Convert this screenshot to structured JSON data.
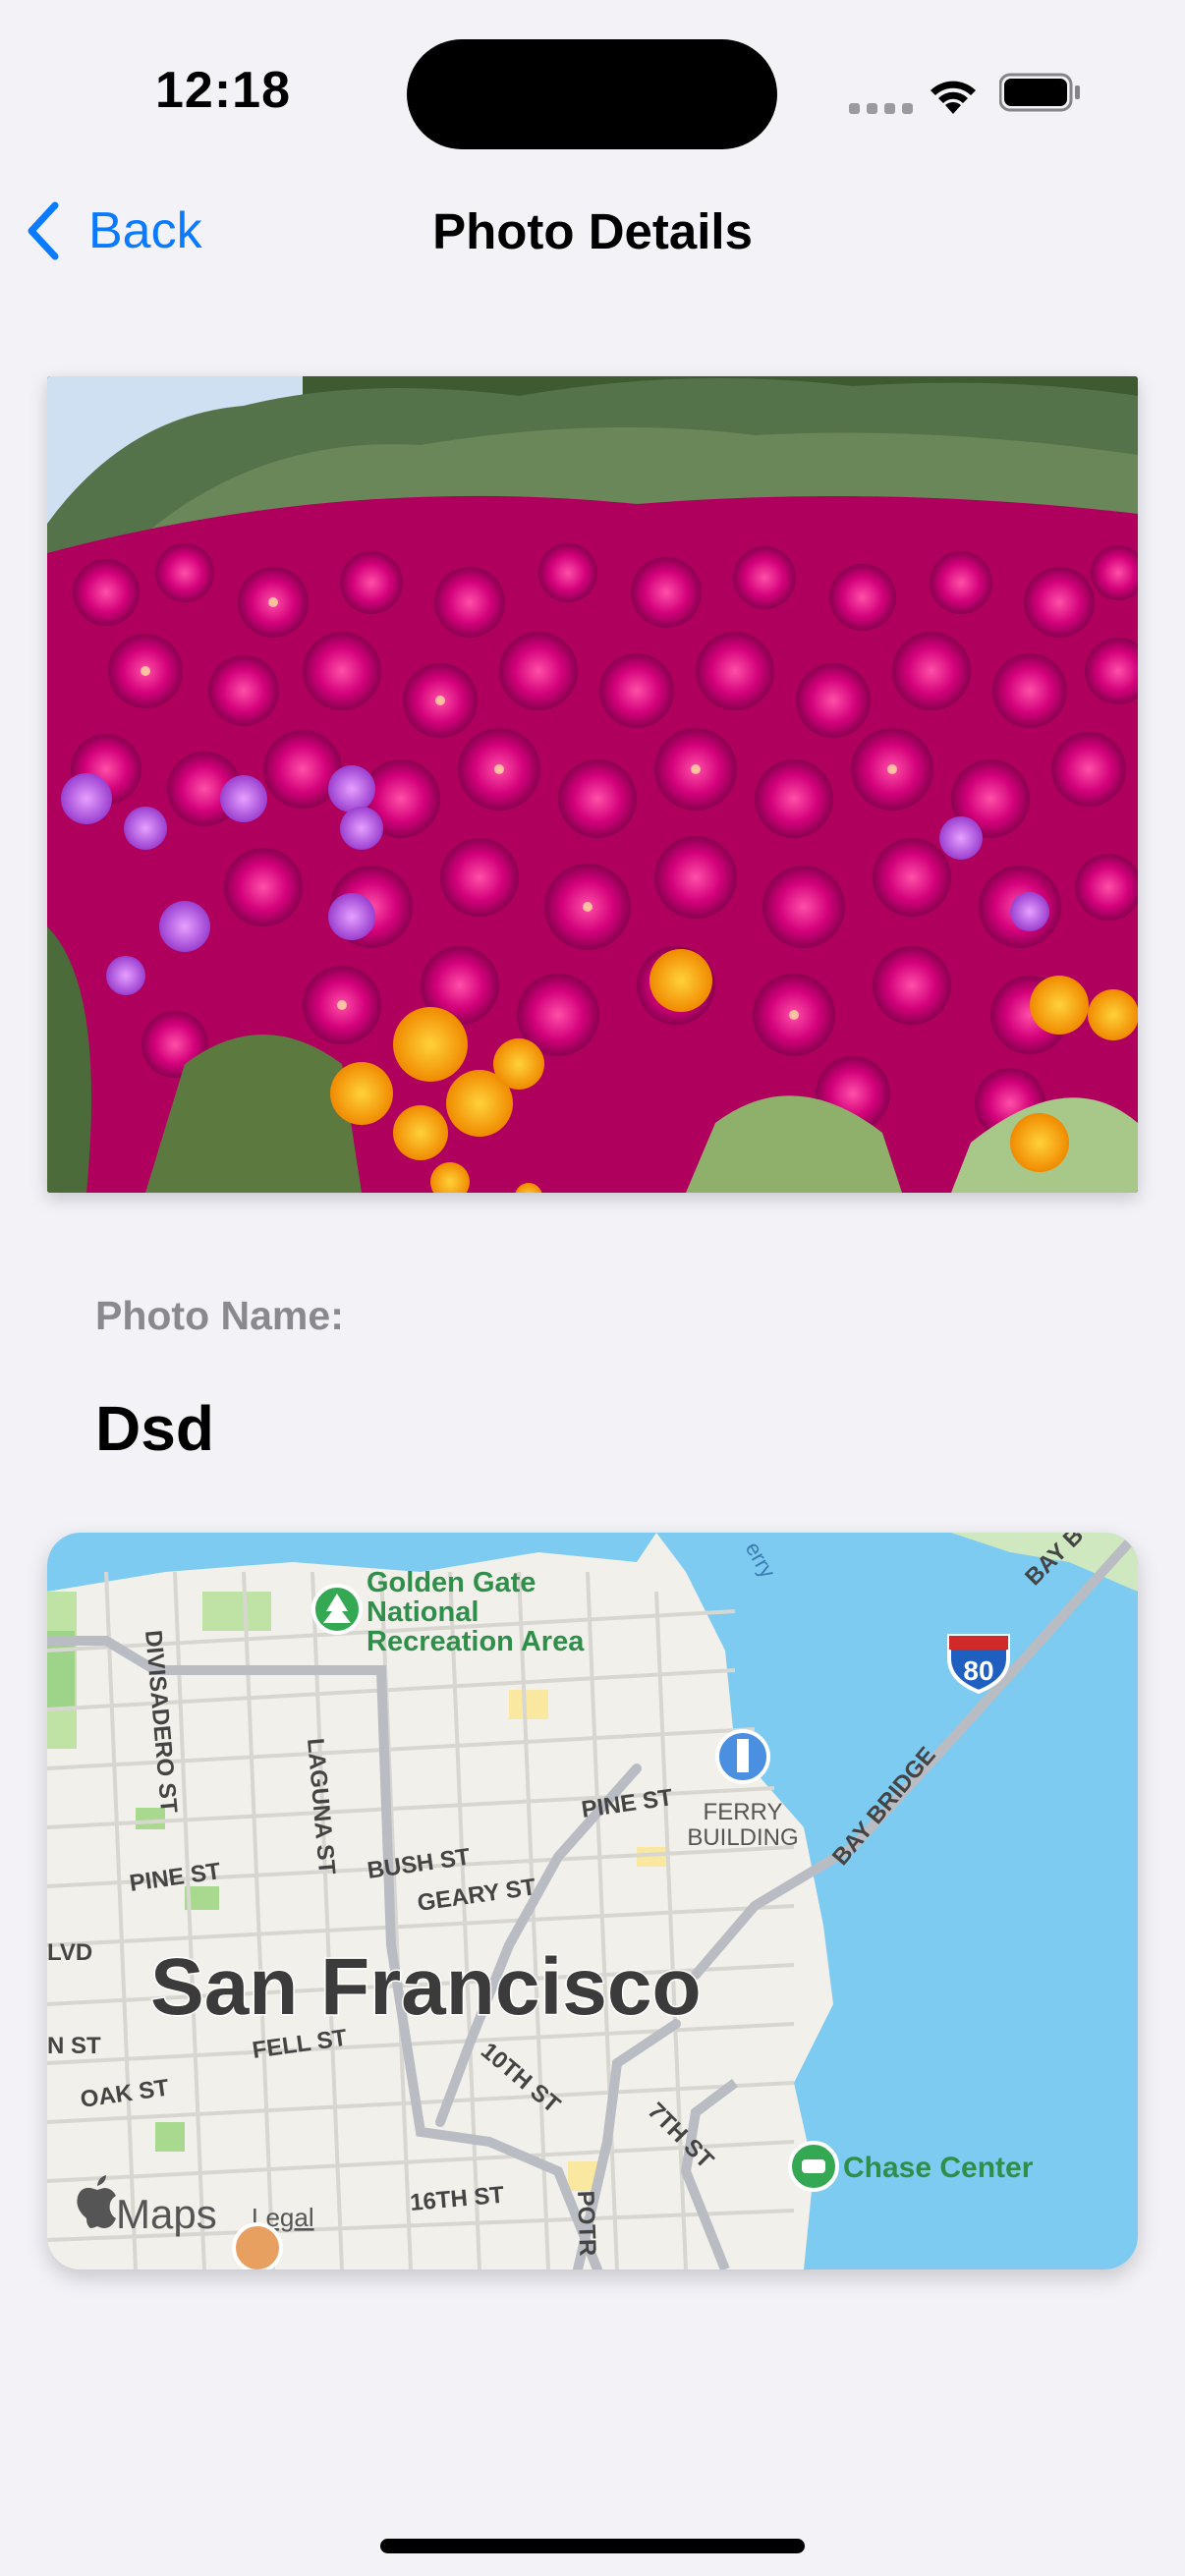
{
  "status_bar": {
    "time": "12:18"
  },
  "nav": {
    "back_label": "Back",
    "title": "Photo Details"
  },
  "photo": {
    "icon": "flower-photo"
  },
  "details": {
    "name_label": "Photo Name:",
    "name_value": "Dsd"
  },
  "map": {
    "city_label": "San Francisco",
    "poi_golden_gate": [
      "Golden Gate",
      "National",
      "Recreation Area"
    ],
    "poi_ferry": [
      "FERRY",
      "BUILDING"
    ],
    "poi_chase": "Chase Center",
    "streets": {
      "divisadero": "DIVISADERO ST",
      "laguna": "LAGUNA ST",
      "pine1": "PINE ST",
      "pine2": "PINE ST",
      "bush": "BUSH ST",
      "geary": "GEARY ST",
      "fell": "FELL ST",
      "oak": "OAK ST",
      "tenth": "10TH ST",
      "seventh": "7TH ST",
      "sixteenth": "16TH ST",
      "potrero": "POTR",
      "bay_bridge": "BAY BRIDGE",
      "bay_top": "BAY B",
      "ferry_water": "erry",
      "blvd": "LVD",
      "st_left": "N ST"
    },
    "highway_shield": "80",
    "brand": "Maps",
    "legal": "Legal"
  }
}
